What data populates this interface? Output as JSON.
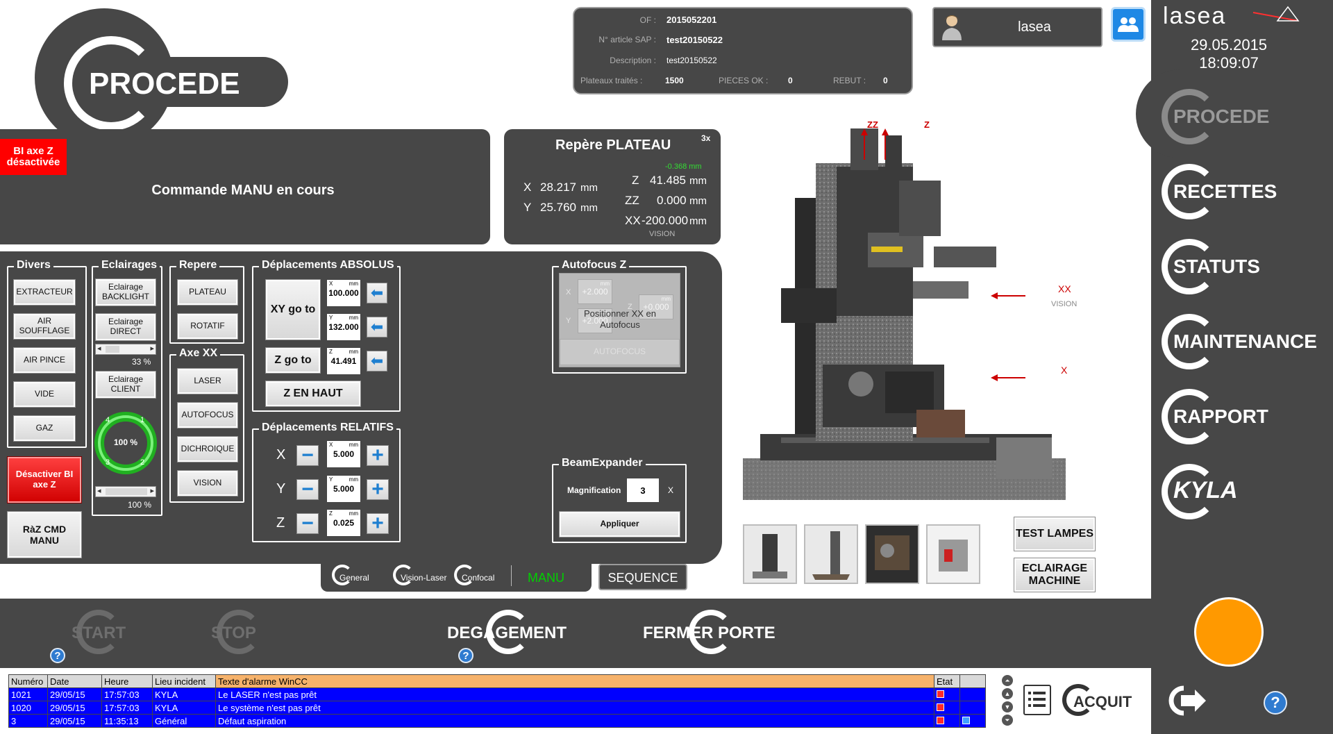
{
  "header": {
    "title": "PROCEDE",
    "of_label": "OF :",
    "of_value": "2015052201",
    "sap_label": "N° article SAP :",
    "sap_value": "test20150522",
    "desc_label": "Description :",
    "desc_value": "test20150522",
    "plateaux_label": "Plateaux traités :",
    "plateaux_value": "1500",
    "pieces_label": "PIECES OK :",
    "pieces_value": "0",
    "rebut_label": "REBUT :",
    "rebut_value": "0",
    "user": "lasea",
    "date": "29.05.2015",
    "time": "18:09:07"
  },
  "status": {
    "warning": "BI axe Z désactivée",
    "command": "Commande MANU en cours"
  },
  "repere": {
    "title": "Repère PLATEAU",
    "zoom": "3x",
    "x_label": "X",
    "x_value": "28.217",
    "x_unit": "mm",
    "y_label": "Y",
    "y_value": "25.760",
    "y_unit": "mm",
    "z_offset": "-0.368 mm",
    "z_label": "Z",
    "z_value": "41.485",
    "z_unit": "mm",
    "zz_label": "ZZ",
    "zz_value": "0.000",
    "zz_unit": "mm",
    "xx_label": "XX",
    "xx_value": "-200.000",
    "xx_unit": "mm",
    "vision": "VISION"
  },
  "divers": {
    "title": "Divers",
    "buttons": [
      "EXTRACTEUR",
      "AIR SOUFFLAGE",
      "AIR PINCE",
      "VIDE",
      "GAZ"
    ],
    "deactivate": "Désactiver BI axe Z",
    "reset": "RàZ CMD MANU"
  },
  "eclairages": {
    "title": "Eclairages",
    "backlight": "Eclairage BACKLIGHT",
    "direct": "Eclairage DIRECT",
    "direct_pct": "33 %",
    "direct_level": 0.33,
    "client": "Eclairage CLIENT",
    "ring_pct": "100 %",
    "ring_nums": [
      "1",
      "2",
      "3",
      "4"
    ],
    "client_pct": "100 %",
    "client_level": 1.0
  },
  "repere_group": {
    "title": "Repere",
    "buttons": [
      "PLATEAU",
      "ROTATIF"
    ]
  },
  "axe_xx": {
    "title": "Axe XX",
    "buttons": [
      "LASER",
      "AUTOFOCUS",
      "DICHROIQUE",
      "VISION"
    ]
  },
  "absolus": {
    "title": "Déplacements ABSOLUS",
    "xy_goto": "XY go to",
    "z_goto": "Z go to",
    "z_haut": "Z EN HAUT",
    "x_label": "X",
    "x_value": "100.000",
    "y_label": "Y",
    "y_value": "132.000",
    "z_label": "Z",
    "z_value": "41.491",
    "unit": "mm"
  },
  "relatifs": {
    "title": "Déplacements RELATIFS",
    "x_label": "X",
    "x_value": "5.000",
    "y_label": "Y",
    "y_value": "5.000",
    "z_label": "Z",
    "z_value": "0.025",
    "unit": "mm"
  },
  "autofocus": {
    "title": "Autofocus Z",
    "x_label": "X",
    "x_value": "+2.000",
    "y_label": "Y",
    "y_value": "+2.000",
    "z_label": "Z",
    "z_value": "+0.000",
    "unit": "mm",
    "overlay": "Positionner XX en Autofocus",
    "button": "AUTOFOCUS"
  },
  "beam": {
    "title": "BeamExpander",
    "mag_label": "Magnification",
    "mag_value": "3",
    "mag_unit": "X",
    "apply": "Appliquer"
  },
  "machine": {
    "zz": "ZZ",
    "z": "Z",
    "xx": "XX",
    "xx_sub": "VISION",
    "x": "X"
  },
  "side_buttons": {
    "test": "TEST LAMPES",
    "eclairage": "ECLAIRAGE MACHINE"
  },
  "modes": {
    "general": "General",
    "vision_laser": "Vision-Laser",
    "confocal": "Confocal",
    "manu": "MANU",
    "sequence": "SEQUENCE"
  },
  "actions": {
    "start": "START",
    "stop": "STOP",
    "degagement": "DEGAGEMENT",
    "fermer": "FERMER PORTE",
    "acquit": "ACQUIT"
  },
  "nav": [
    "PROCEDE",
    "RECETTES",
    "STATUTS",
    "MAINTENANCE",
    "RAPPORT",
    "KYLA"
  ],
  "alarms": {
    "headers": [
      "Numéro",
      "Date",
      "Heure",
      "Lieu incident",
      "Texte d'alarme WinCC",
      "Etat"
    ],
    "rows": [
      [
        "1021",
        "29/05/15",
        "17:57:03",
        "KYLA",
        "Le LASER n'est pas prêt"
      ],
      [
        "1020",
        "29/05/15",
        "17:57:03",
        "KYLA",
        "Le système n'est pas prêt"
      ],
      [
        "3",
        "29/05/15",
        "11:35:13",
        "Général",
        "Défaut aspiration"
      ]
    ]
  },
  "colors": {
    "panel": "#474747",
    "warning": "#ff0000",
    "manu": "#00d000",
    "alarm_row": "#0000ff",
    "orange": "#ff9900",
    "ring": "#22cc22"
  }
}
